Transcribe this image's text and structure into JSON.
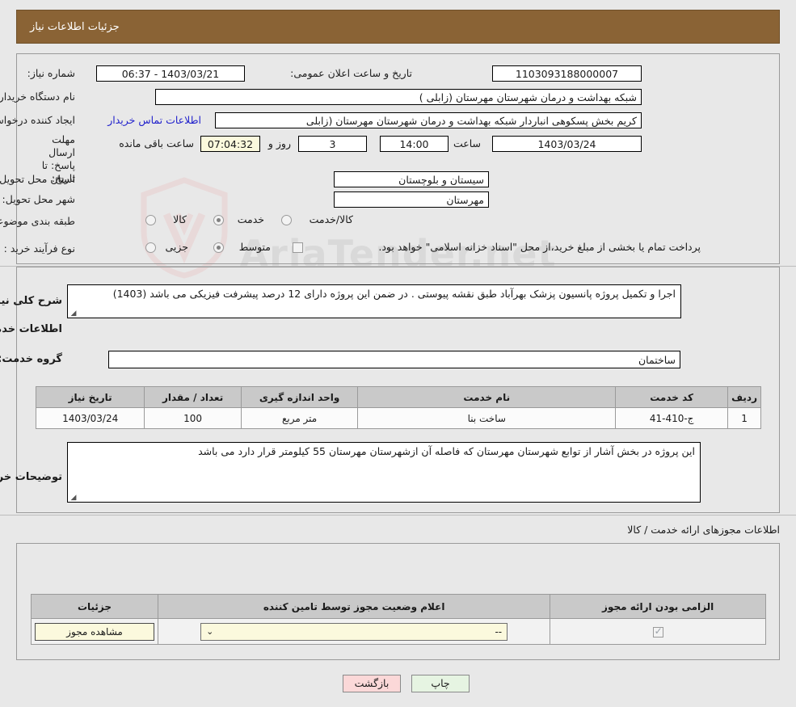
{
  "header": {
    "title": "جزئیات اطلاعات نیاز"
  },
  "main_info": {
    "need_number_label": "شماره نیاز:",
    "need_number_value": "1103093188000007",
    "announce_datetime_label": "تاریخ و ساعت اعلان عمومی:",
    "announce_datetime_value": "1403/03/21 - 06:37",
    "buyer_org_label": "نام دستگاه خریدار:",
    "buyer_org_value": "شبکه بهداشت و درمان شهرستان مهرستان (زابلی )",
    "requester_label": "ایجاد کننده درخواست:",
    "requester_value": "کریم بخش پسکوهی انباردار شبکه بهداشت و درمان شهرستان مهرستان (زابلی",
    "buyer_contact_link": "اطلاعات تماس خریدار",
    "deadline_label": "مهلت ارسال پاسخ: تا تاریخ:",
    "deadline_date": "1403/03/24",
    "hour_label": "ساعت",
    "deadline_time": "14:00",
    "days_value": "3",
    "days_label": "روز و",
    "remaining_value": "07:04:32",
    "remaining_label": "ساعت باقی مانده",
    "province_label": "استان محل تحویل:",
    "province_value": "سیستان و بلوچستان",
    "city_label": "شهر محل تحویل:",
    "city_value": "مهرستان",
    "category_label": "طبقه بندی موضوعی:",
    "category_options": [
      "کالا",
      "خدمت",
      "کالا/خدمت"
    ],
    "category_selected": "خدمت",
    "process_label": "نوع فرآیند خرید :",
    "process_options": [
      "جزیی",
      "متوسط"
    ],
    "process_selected": "متوسط",
    "treasury_checkbox_label": "پرداخت تمام یا بخشی از مبلغ خرید،از محل \"اسناد خزانه اسلامی\" خواهد بود.",
    "treasury_checked": false
  },
  "description": {
    "label": "شرح کلی نیاز:",
    "value": "اجرا و تکمیل  پروژه  پانسیون پزشک بهرآباد طبق نقشه پیوستی . در ضمن این پروژه دارای 12 درصد پیشرفت فیزیکی می باشد (1403)"
  },
  "services_section": {
    "heading": "اطلاعات خدمات مورد نیاز",
    "service_group_label": "گروه خدمت:",
    "service_group_value": "ساختمان",
    "columns": [
      "ردیف",
      "کد خدمت",
      "نام خدمت",
      "واحد اندازه گیری",
      "تعداد / مقدار",
      "تاریخ نیاز"
    ],
    "rows": [
      {
        "row_no": "1",
        "service_code": "ج-410-41",
        "service_name": "ساخت بنا",
        "unit": "متر مربع",
        "quantity": "100",
        "need_date": "1403/03/24"
      }
    ]
  },
  "buyer_notes": {
    "label": "توضیحات خریدار:",
    "value": "این پروژه در بخش آشار از توابع شهرستان مهرستان  که فاصله آن ازشهرستان مهرستان 55 کیلومتر قرار دارد می باشد"
  },
  "licenses_section": {
    "heading": "اطلاعات مجوزهای ارائه خدمت / کالا",
    "columns": [
      "الزامی بودن ارائه مجوز",
      "اعلام وضعیت مجوز توسط تامین کننده",
      "جزئیات"
    ],
    "rows": [
      {
        "required_checked": true,
        "status_value": "--",
        "details_button": "مشاهده مجوز"
      }
    ]
  },
  "footer": {
    "print_label": "چاپ",
    "back_label": "بازگشت"
  },
  "watermark": {
    "text": "AriaTender.net"
  },
  "colors": {
    "header_bar": "#8a6335",
    "link": "#2222cc",
    "back_button": "#fbd8d8",
    "print_button": "#e6f4e2",
    "table_header": "#c9c9c9",
    "input_yellow": "#fbf9dd"
  }
}
